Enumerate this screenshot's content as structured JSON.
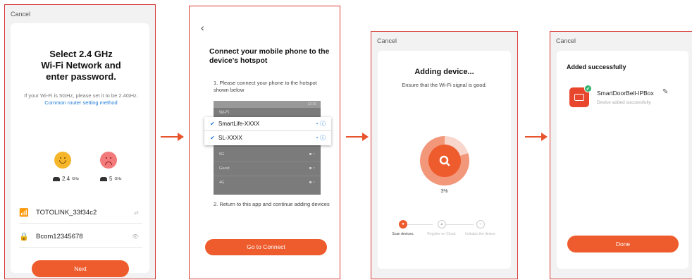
{
  "colors": {
    "accent": "#ee5b2c",
    "link": "#1f7bd8",
    "frame": "#d93a36"
  },
  "screen1": {
    "cancel": "Cancel",
    "title_lines": [
      "Select 2.4 GHz",
      "Wi-Fi Network and",
      "enter password."
    ],
    "note": "If your Wi-Fi is 5GHz, please set it to be 2.4GHz.",
    "note_link": "Common router setting method",
    "band_24": "2.4",
    "band_5": "5",
    "band_unit": "GHz",
    "ssid": "TOTOLINK_33f34c2",
    "password": "Bcom12345678",
    "next": "Next"
  },
  "screen2": {
    "title": "Connect your mobile phone to the device's hotspot",
    "step1": "1. Please connect your phone to the hotspot shown below",
    "phone_header": "Wi-Fi",
    "phone_time": "12:30",
    "selected_networks": [
      "SmartLife-XXXX",
      "SL-XXXX"
    ],
    "other_networks": [
      "5G",
      "Guest",
      "4G"
    ],
    "step2": "2. Return to this app and continue adding devices",
    "connect": "Go to Connect"
  },
  "screen3": {
    "cancel": "Cancel",
    "title": "Adding device...",
    "subtitle": "Ensure that the Wi-Fi signal is good.",
    "progress_label": "3%",
    "progress": 0.03,
    "steps": [
      "Scan devices.",
      "Register on Cloud.",
      "Initialize the device."
    ]
  },
  "screen4": {
    "cancel": "Cancel",
    "title": "Added successfully",
    "device_name": "SmartDoorBell-IPBox",
    "device_status": "Device added successfully",
    "done": "Done"
  }
}
